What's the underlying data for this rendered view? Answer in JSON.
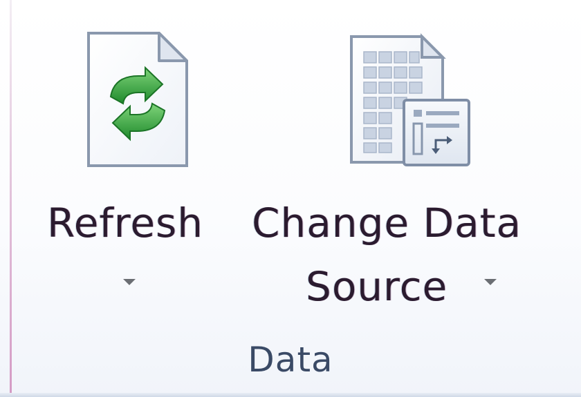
{
  "ribbon_group": {
    "label": "Data",
    "buttons": [
      {
        "id": "refresh",
        "label": "Refresh",
        "icon": "refresh-document-icon",
        "has_dropdown": true
      },
      {
        "id": "change_data_source",
        "label_line1": "Change Data",
        "label_line2": "Source",
        "icon": "change-data-source-icon",
        "has_dropdown": true
      }
    ]
  },
  "colors": {
    "refresh_arrow_green": "#2f9a3a",
    "document_border": "#8a98ad",
    "label_text": "#2b1b2f",
    "group_label_text": "#3a4a66"
  }
}
